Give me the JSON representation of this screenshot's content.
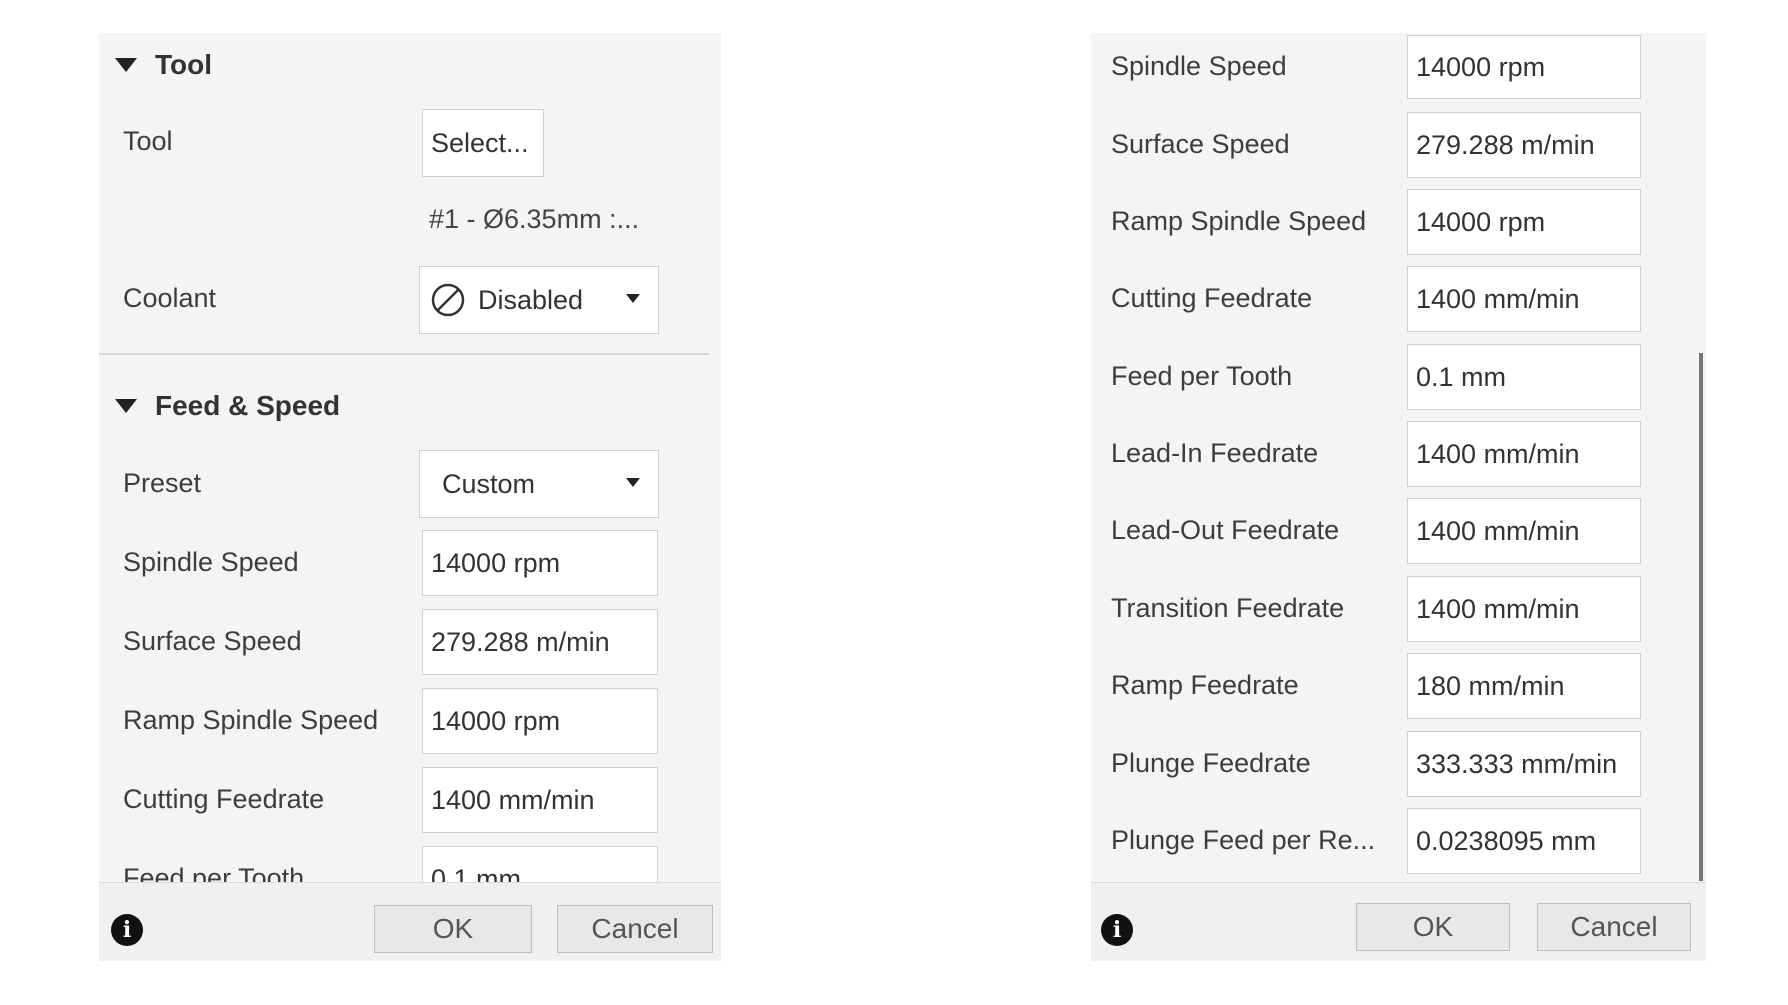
{
  "left_panel": {
    "tool_section": {
      "title": "Tool",
      "tool_label": "Tool",
      "tool_button": "Select...",
      "tool_info": "#1 - Ø6.35mm :...",
      "coolant_label": "Coolant",
      "coolant_value": "Disabled"
    },
    "feed_section": {
      "title": "Feed & Speed",
      "preset_label": "Preset",
      "preset_value": "Custom",
      "rows": [
        {
          "label": "Spindle Speed",
          "value": "14000 rpm"
        },
        {
          "label": "Surface Speed",
          "value": "279.288 m/min"
        },
        {
          "label": "Ramp Spindle Speed",
          "value": "14000 rpm"
        },
        {
          "label": "Cutting Feedrate",
          "value": "1400 mm/min"
        },
        {
          "label": "Feed per Tooth",
          "value": "0.1 mm"
        }
      ]
    },
    "footer": {
      "ok": "OK",
      "cancel": "Cancel"
    }
  },
  "right_panel": {
    "rows": [
      {
        "label": "Spindle Speed",
        "value": "14000 rpm"
      },
      {
        "label": "Surface Speed",
        "value": "279.288 m/min"
      },
      {
        "label": "Ramp Spindle Speed",
        "value": "14000 rpm"
      },
      {
        "label": "Cutting Feedrate",
        "value": "1400 mm/min"
      },
      {
        "label": "Feed per Tooth",
        "value": "0.1 mm"
      },
      {
        "label": "Lead-In Feedrate",
        "value": "1400 mm/min"
      },
      {
        "label": "Lead-Out Feedrate",
        "value": "1400 mm/min"
      },
      {
        "label": "Transition Feedrate",
        "value": "1400 mm/min"
      },
      {
        "label": "Ramp Feedrate",
        "value": "180 mm/min"
      },
      {
        "label": "Plunge Feedrate",
        "value": "333.333 mm/min"
      },
      {
        "label": "Plunge Feed per Re...",
        "value": "0.0238095 mm"
      }
    ],
    "footer": {
      "ok": "OK",
      "cancel": "Cancel"
    }
  },
  "icons": {
    "info": "info-icon",
    "coolant_disabled": "disabled-circle-icon",
    "caret": "chevron-down-icon",
    "section_toggle": "collapse-triangle-icon"
  }
}
